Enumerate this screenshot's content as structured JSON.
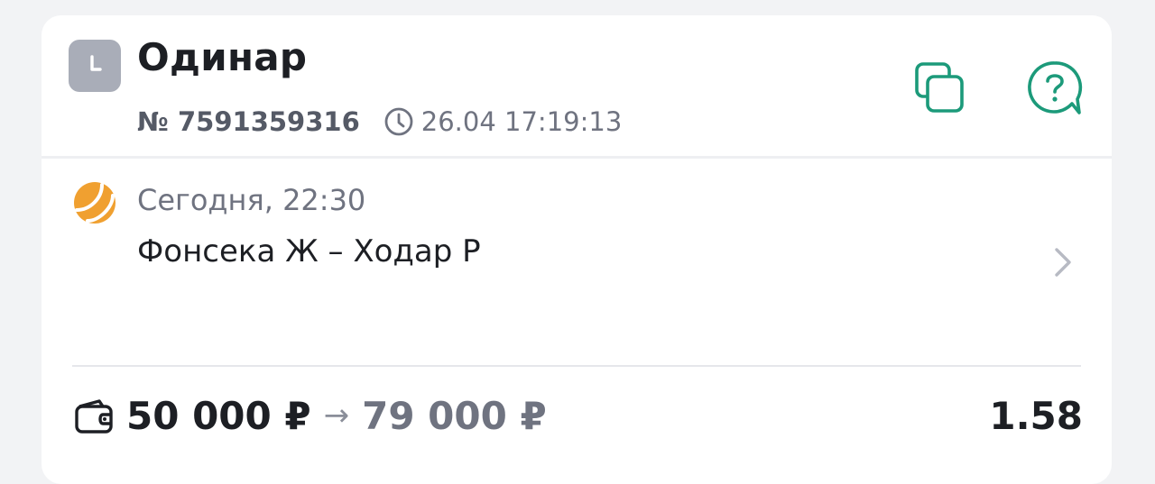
{
  "colors": {
    "accent": "#1c9a7a",
    "sport_icon": "#f0a030",
    "badge": "#a9adb8"
  },
  "header": {
    "badge_icon": "clock-icon",
    "title": "Одинар",
    "bet_number": "№ 7591359316",
    "datetime": "26.04 17:19:13",
    "copy_icon": "copy-icon",
    "help_icon": "help-icon"
  },
  "event": {
    "sport_icon": "tennis-ball-icon",
    "time": "Сегодня, 22:30",
    "teams": "Фонсека Ж – Ходар Р"
  },
  "bet": {
    "wallet_icon": "wallet-icon",
    "stake": "50 000 ₽",
    "arrow": "→",
    "payout": "79 000 ₽",
    "odds": "1.58"
  }
}
